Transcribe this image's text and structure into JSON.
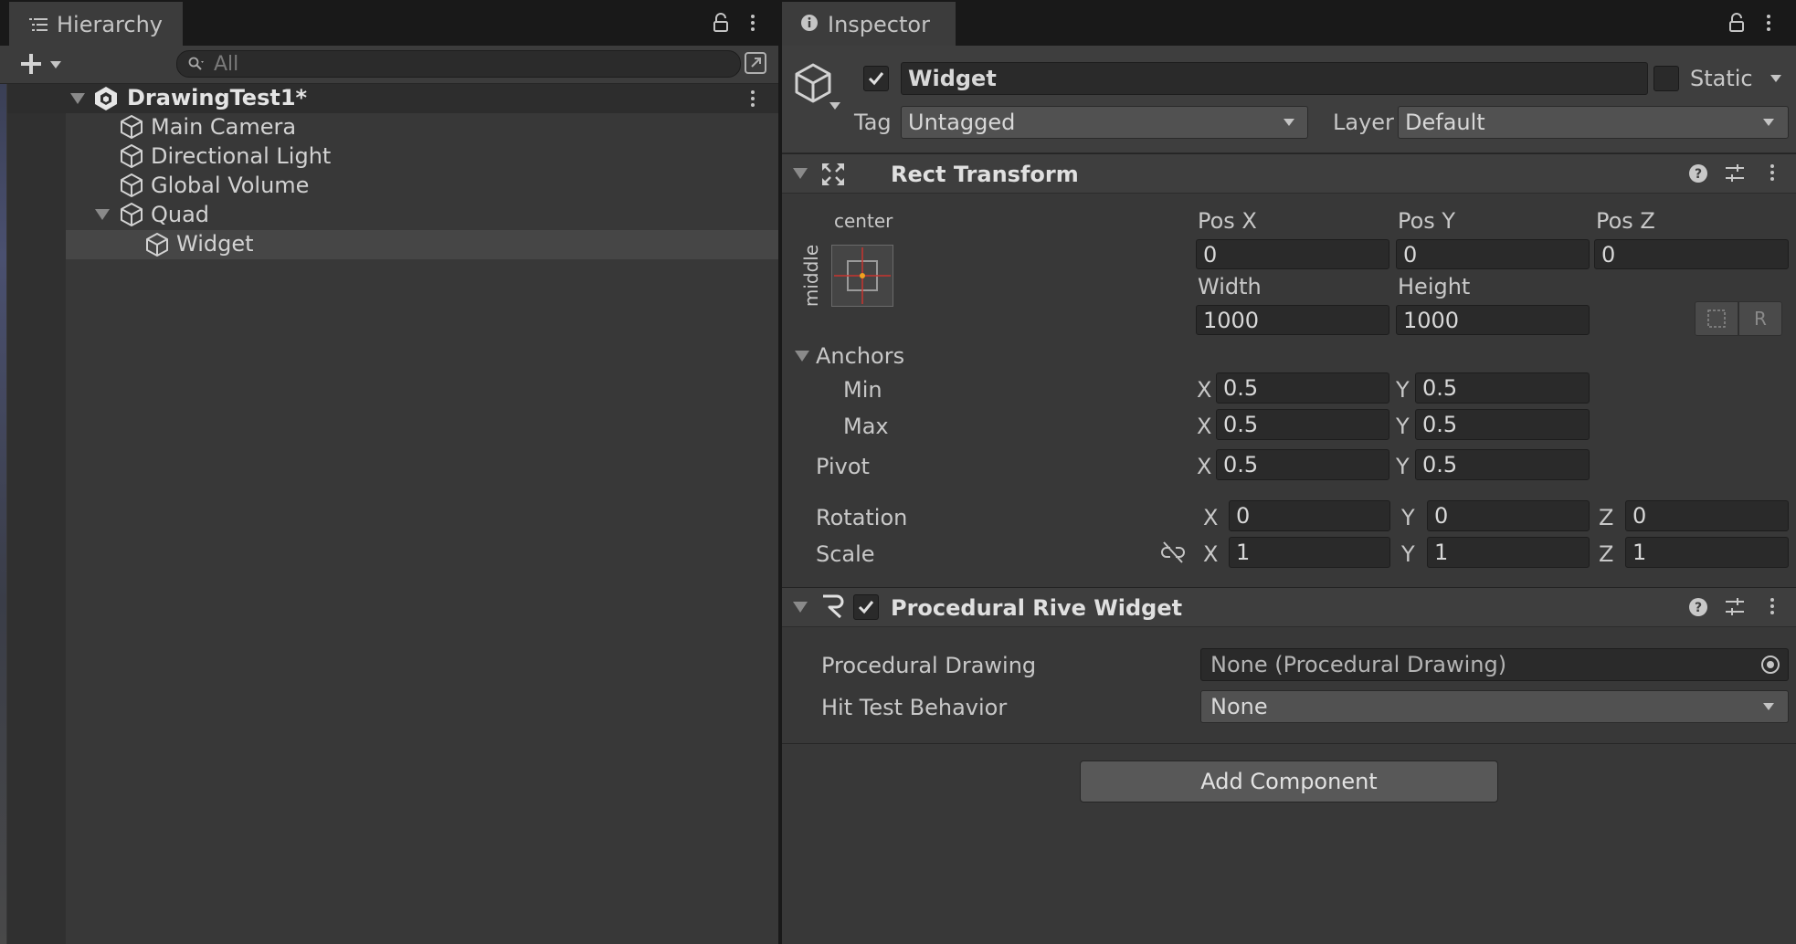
{
  "hierarchy": {
    "tab_label": "Hierarchy",
    "search_placeholder": "All",
    "scene_name": "DrawingTest1*",
    "items": [
      {
        "label": "Main Camera"
      },
      {
        "label": "Directional Light"
      },
      {
        "label": "Global Volume"
      },
      {
        "label": "Quad"
      },
      {
        "label": "Widget"
      }
    ]
  },
  "inspector": {
    "tab_label": "Inspector",
    "object": {
      "name": "Widget",
      "active": true,
      "static_label": "Static",
      "tag_label": "Tag",
      "tag_value": "Untagged",
      "layer_label": "Layer",
      "layer_value": "Default"
    },
    "rect_transform": {
      "title": "Rect Transform",
      "anchor_preset_h": "center",
      "anchor_preset_v": "middle",
      "pos_x_label": "Pos X",
      "pos_y_label": "Pos Y",
      "pos_z_label": "Pos Z",
      "pos_x": "0",
      "pos_y": "0",
      "pos_z": "0",
      "width_label": "Width",
      "height_label": "Height",
      "width": "1000",
      "height": "1000",
      "raw_edit_label": "R",
      "anchors_label": "Anchors",
      "min_label": "Min",
      "max_label": "Max",
      "pivot_label": "Pivot",
      "rotation_label": "Rotation",
      "scale_label": "Scale",
      "x_label": "X",
      "y_label": "Y",
      "z_label": "Z",
      "anchor_min_x": "0.5",
      "anchor_min_y": "0.5",
      "anchor_max_x": "0.5",
      "anchor_max_y": "0.5",
      "pivot_x": "0.5",
      "pivot_y": "0.5",
      "rotation_x": "0",
      "rotation_y": "0",
      "rotation_z": "0",
      "scale_x": "1",
      "scale_y": "1",
      "scale_z": "1"
    },
    "procedural_widget": {
      "title": "Procedural Rive Widget",
      "enabled": true,
      "drawing_label": "Procedural Drawing",
      "drawing_value": "None (Procedural Drawing)",
      "hit_test_label": "Hit Test Behavior",
      "hit_test_value": "None"
    },
    "add_component_label": "Add Component"
  },
  "colors": {
    "panel_bg": "#383838",
    "tab_bar_bg": "#191919",
    "field_bg": "#2a2a2a",
    "selected_row": "#464646",
    "anchor_red": "#c8352e",
    "anchor_orange": "#f0a020"
  }
}
